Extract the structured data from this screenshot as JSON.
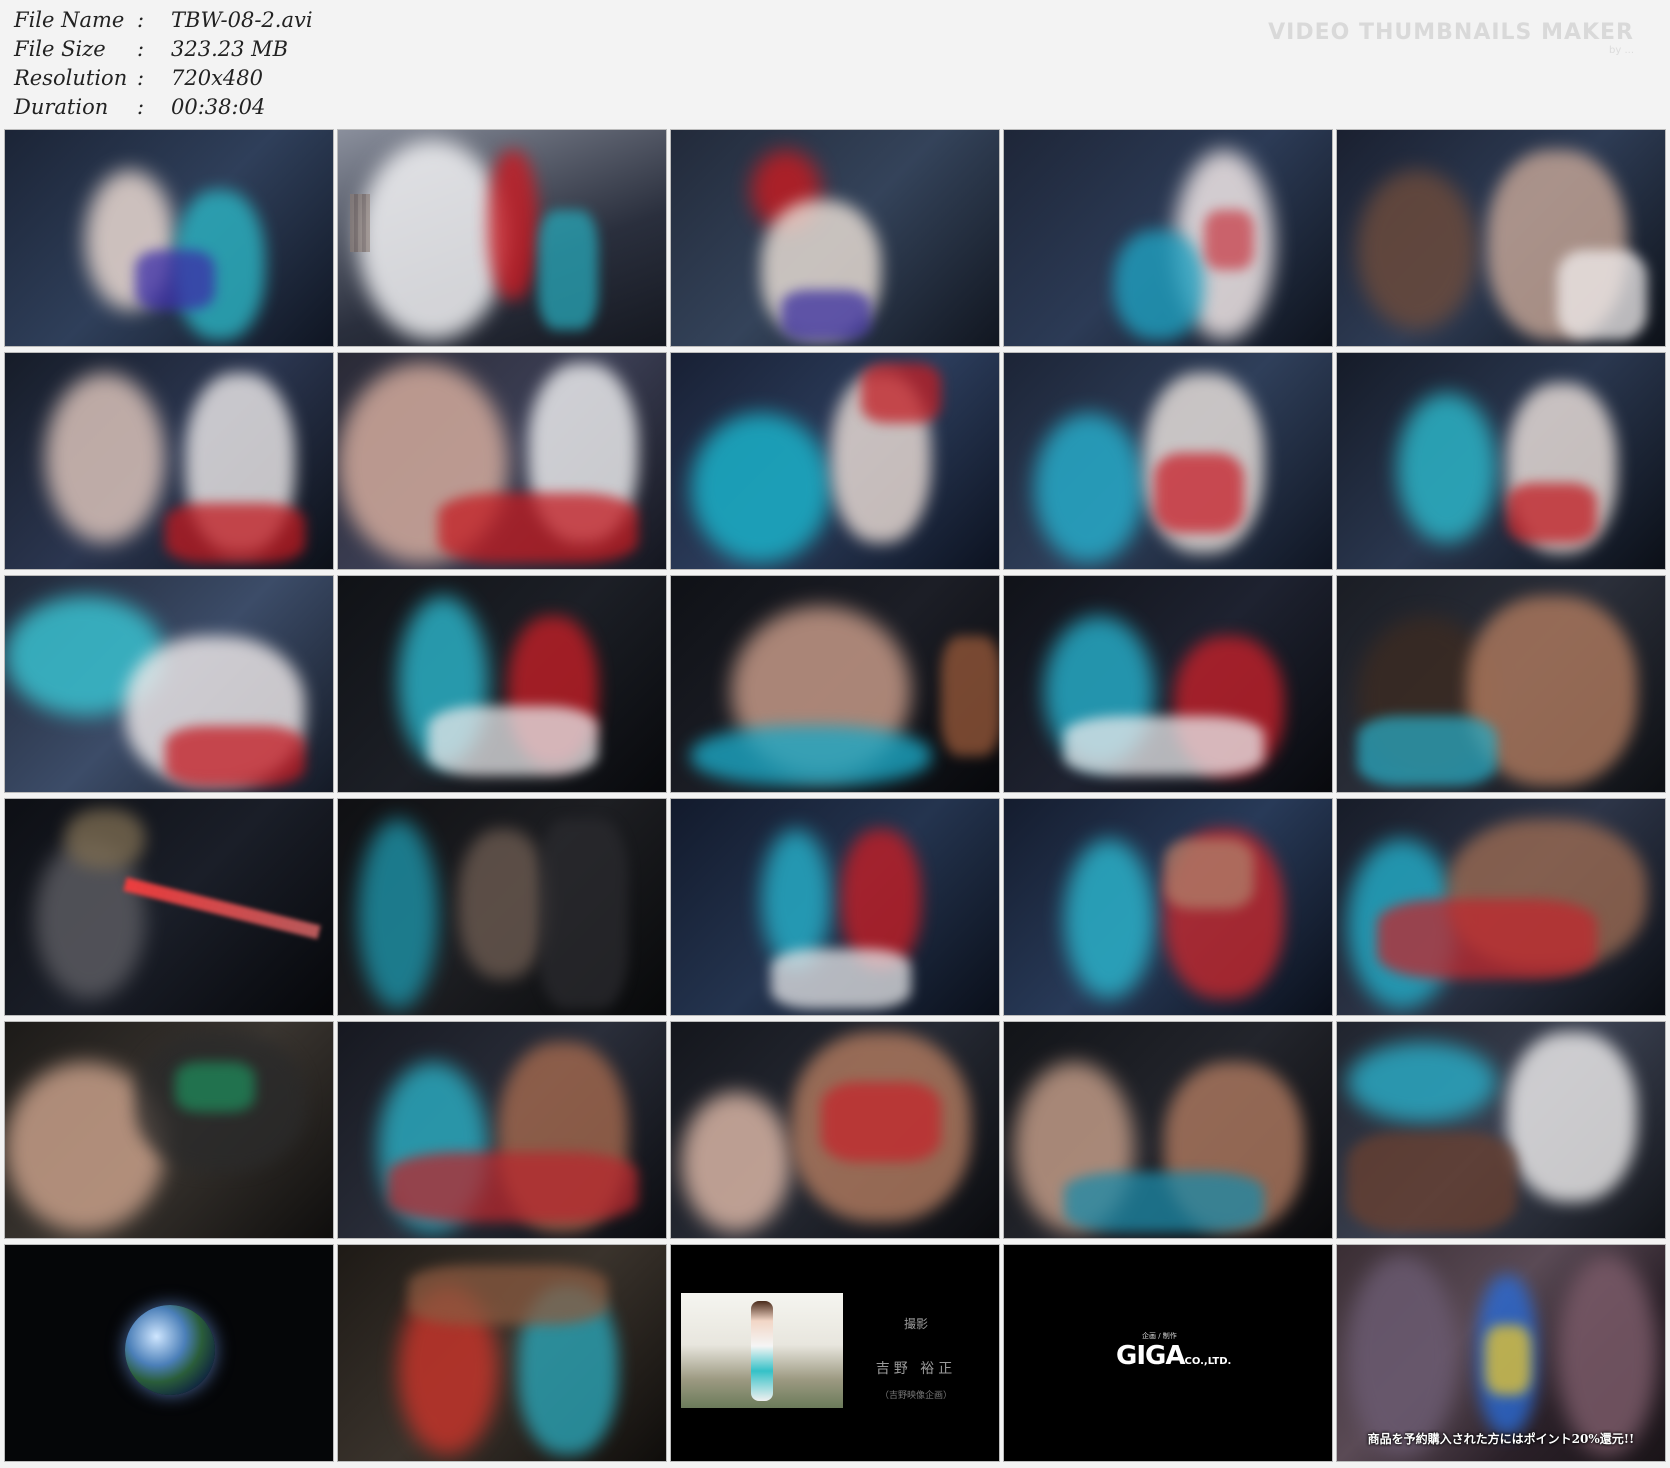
{
  "info": {
    "file_name_label": "File Name",
    "file_name": "TBW-08-2.avi",
    "file_size_label": "File Size",
    "file_size": "323.23 MB",
    "resolution_label": "Resolution",
    "resolution": "720x480",
    "duration_label": "Duration",
    "duration": "00:38:04",
    "separator": ":"
  },
  "watermark": {
    "title": "VIDEO THUMBNAILS MAKER",
    "subtitle": "by ..."
  },
  "credits": {
    "role": "撮影",
    "name": "吉野 裕正",
    "company": "（吉野映像企画）"
  },
  "giga_logo": {
    "small": "企画 / 制作",
    "main": "GIGA",
    "suffix": "CO.,LTD."
  },
  "promo_text": "商品を予約購入された方にはポイント20%還元!!",
  "colors": {
    "background": "#f3f3f3",
    "text": "#222222",
    "thumb_dark": "#14161e"
  }
}
